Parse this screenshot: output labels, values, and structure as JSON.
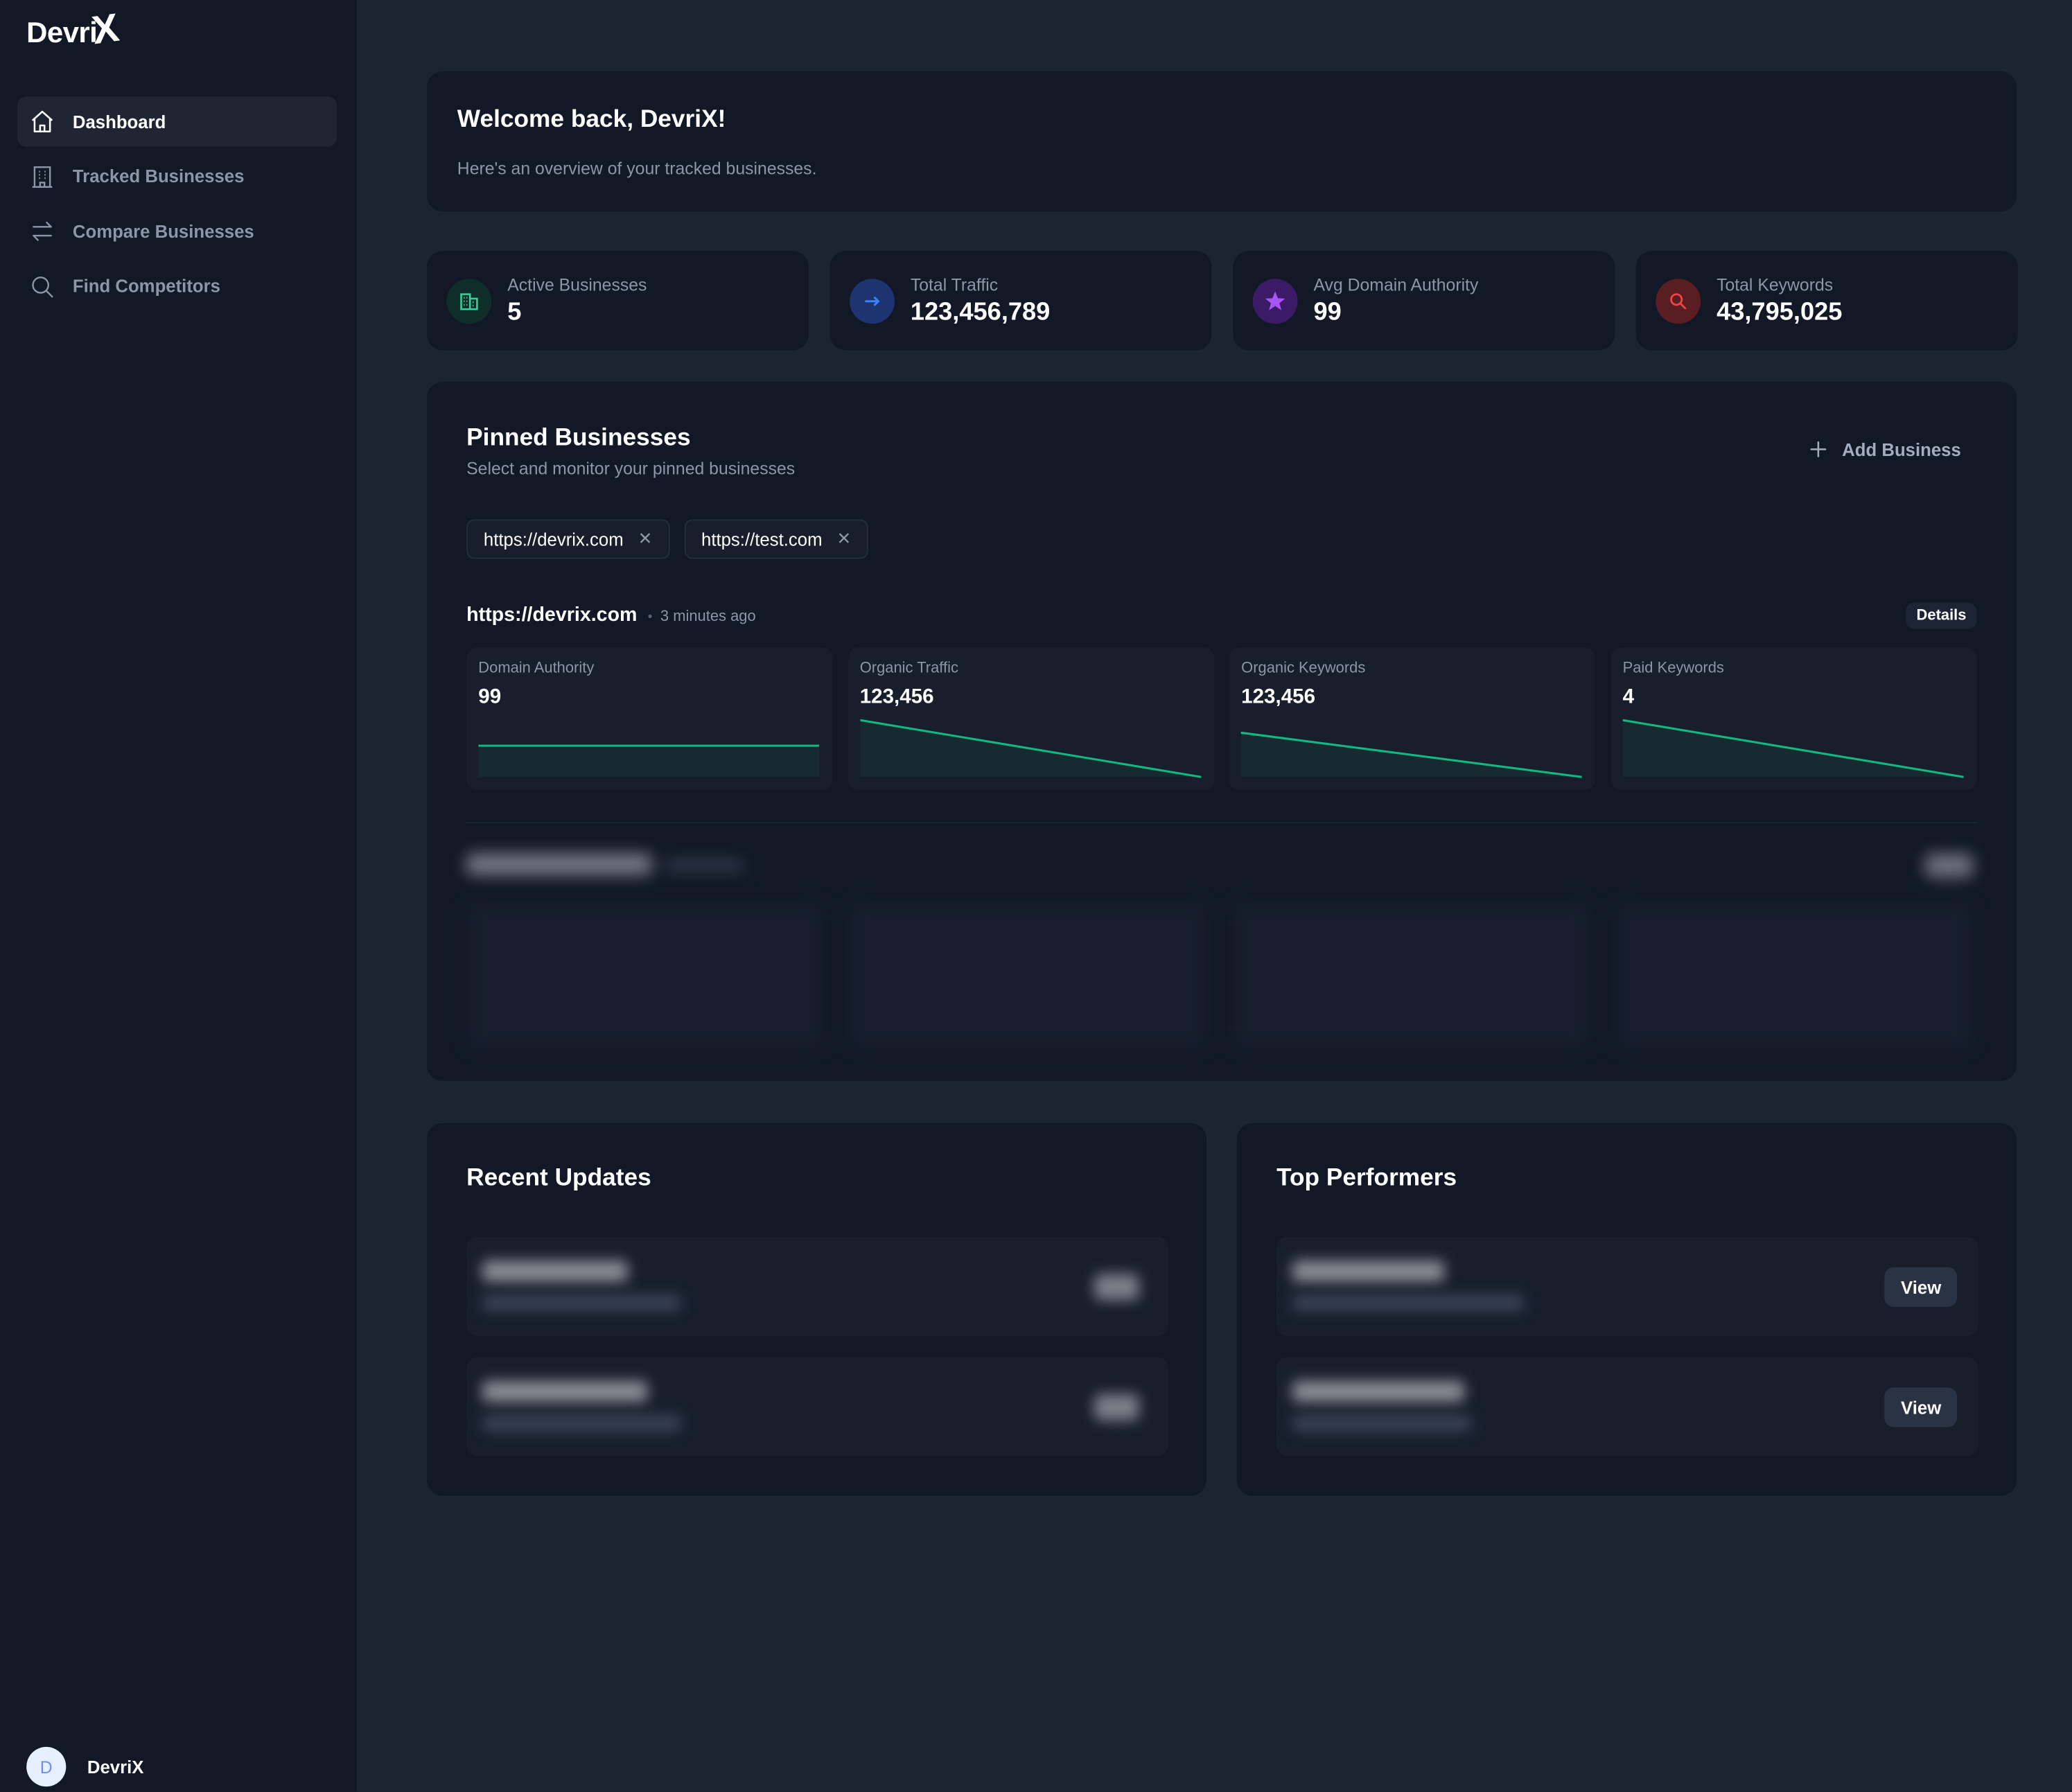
{
  "app": {
    "logo_text": "Devri",
    "logo_mark": "X"
  },
  "sidebar": {
    "items": [
      {
        "label": "Dashboard",
        "icon": "home-icon",
        "active": true
      },
      {
        "label": "Tracked Businesses",
        "icon": "building-icon",
        "active": false
      },
      {
        "label": "Compare Businesses",
        "icon": "arrows-swap-icon",
        "active": false
      },
      {
        "label": "Find Competitors",
        "icon": "search-icon",
        "active": false
      }
    ],
    "user": {
      "initial": "D",
      "name": "DevriX"
    }
  },
  "welcome": {
    "title": "Welcome back, DevriX!",
    "subtitle": "Here's an overview of your tracked businesses."
  },
  "stats": [
    {
      "label": "Active Businesses",
      "value": "5",
      "icon": "building-icon",
      "color": "#34d399",
      "bg": "#0f2e2a"
    },
    {
      "label": "Total Traffic",
      "value": "123,456,789",
      "icon": "arrow-right-icon",
      "color": "#3b82f6",
      "bg": "#1e3470"
    },
    {
      "label": "Avg Domain Authority",
      "value": "99",
      "icon": "star-icon",
      "color": "#a855f7",
      "bg": "#3b1a66"
    },
    {
      "label": "Total Keywords",
      "value": "43,795,025",
      "icon": "search-icon",
      "color": "#ef4444",
      "bg": "#5a1d22"
    }
  ],
  "pinned": {
    "title": "Pinned Businesses",
    "subtitle": "Select and monitor your pinned businesses",
    "add_label": "Add Business",
    "chips": [
      "https://devrix.com",
      "https://test.com"
    ],
    "selected": {
      "url": "https://devrix.com",
      "updated": "3 minutes ago",
      "details_label": "Details",
      "metrics": [
        {
          "label": "Domain Authority",
          "value": "99",
          "trend": [
            1,
            1
          ]
        },
        {
          "label": "Organic Traffic",
          "value": "123,456",
          "trend": [
            1,
            0
          ]
        },
        {
          "label": "Organic Keywords",
          "value": "123,456",
          "trend": [
            0.78,
            0
          ]
        },
        {
          "label": "Paid Keywords",
          "value": "4",
          "trend": [
            1,
            0
          ]
        }
      ]
    }
  },
  "recent_updates": {
    "title": "Recent Updates"
  },
  "top_performers": {
    "title": "Top Performers",
    "view_label": "View"
  },
  "colors": {
    "accent_green": "#10b981",
    "sidebar_bg": "#131826",
    "main_bg": "#1c2331",
    "card_bg": "#121826"
  }
}
